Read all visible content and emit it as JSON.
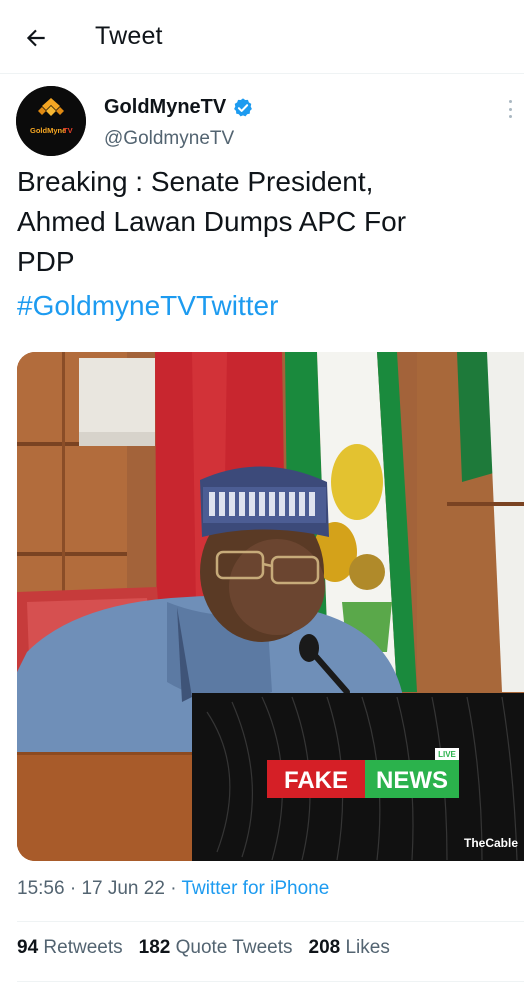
{
  "header": {
    "title": "Tweet",
    "back_icon": "arrow-left-icon"
  },
  "author": {
    "name": "GoldMyneTV",
    "handle": "@GoldmyneTV",
    "verified": true,
    "avatar_text": "GoldMyneTV",
    "avatar_colors": {
      "background": "#0b0b0b",
      "accent": "#f5a623",
      "text": "#e8402a"
    }
  },
  "tweet": {
    "lines": [
      "Breaking : Senate President,",
      "Ahmed Lawan Dumps APC For",
      "PDP"
    ],
    "hashtag": "#GoldmyneTVTwitter"
  },
  "media": {
    "stamp_left": "FAKE",
    "stamp_right": "NEWS",
    "live_tag": "LIVE",
    "watermark": "TheCable",
    "colors": {
      "fake_bg": "#d51f26",
      "news_bg": "#2bb24c"
    }
  },
  "meta": {
    "time": "15:56",
    "date": "17 Jun 22",
    "source": "Twitter for iPhone",
    "separator": "·"
  },
  "stats": {
    "retweets": {
      "count": "94",
      "label": "Retweets"
    },
    "quotes": {
      "count": "182",
      "label": "Quote Tweets"
    },
    "likes": {
      "count": "208",
      "label": "Likes"
    }
  },
  "colors": {
    "link": "#1d9bf0",
    "muted": "#536471",
    "text": "#0f1419",
    "verified": "#1d9bf0"
  }
}
